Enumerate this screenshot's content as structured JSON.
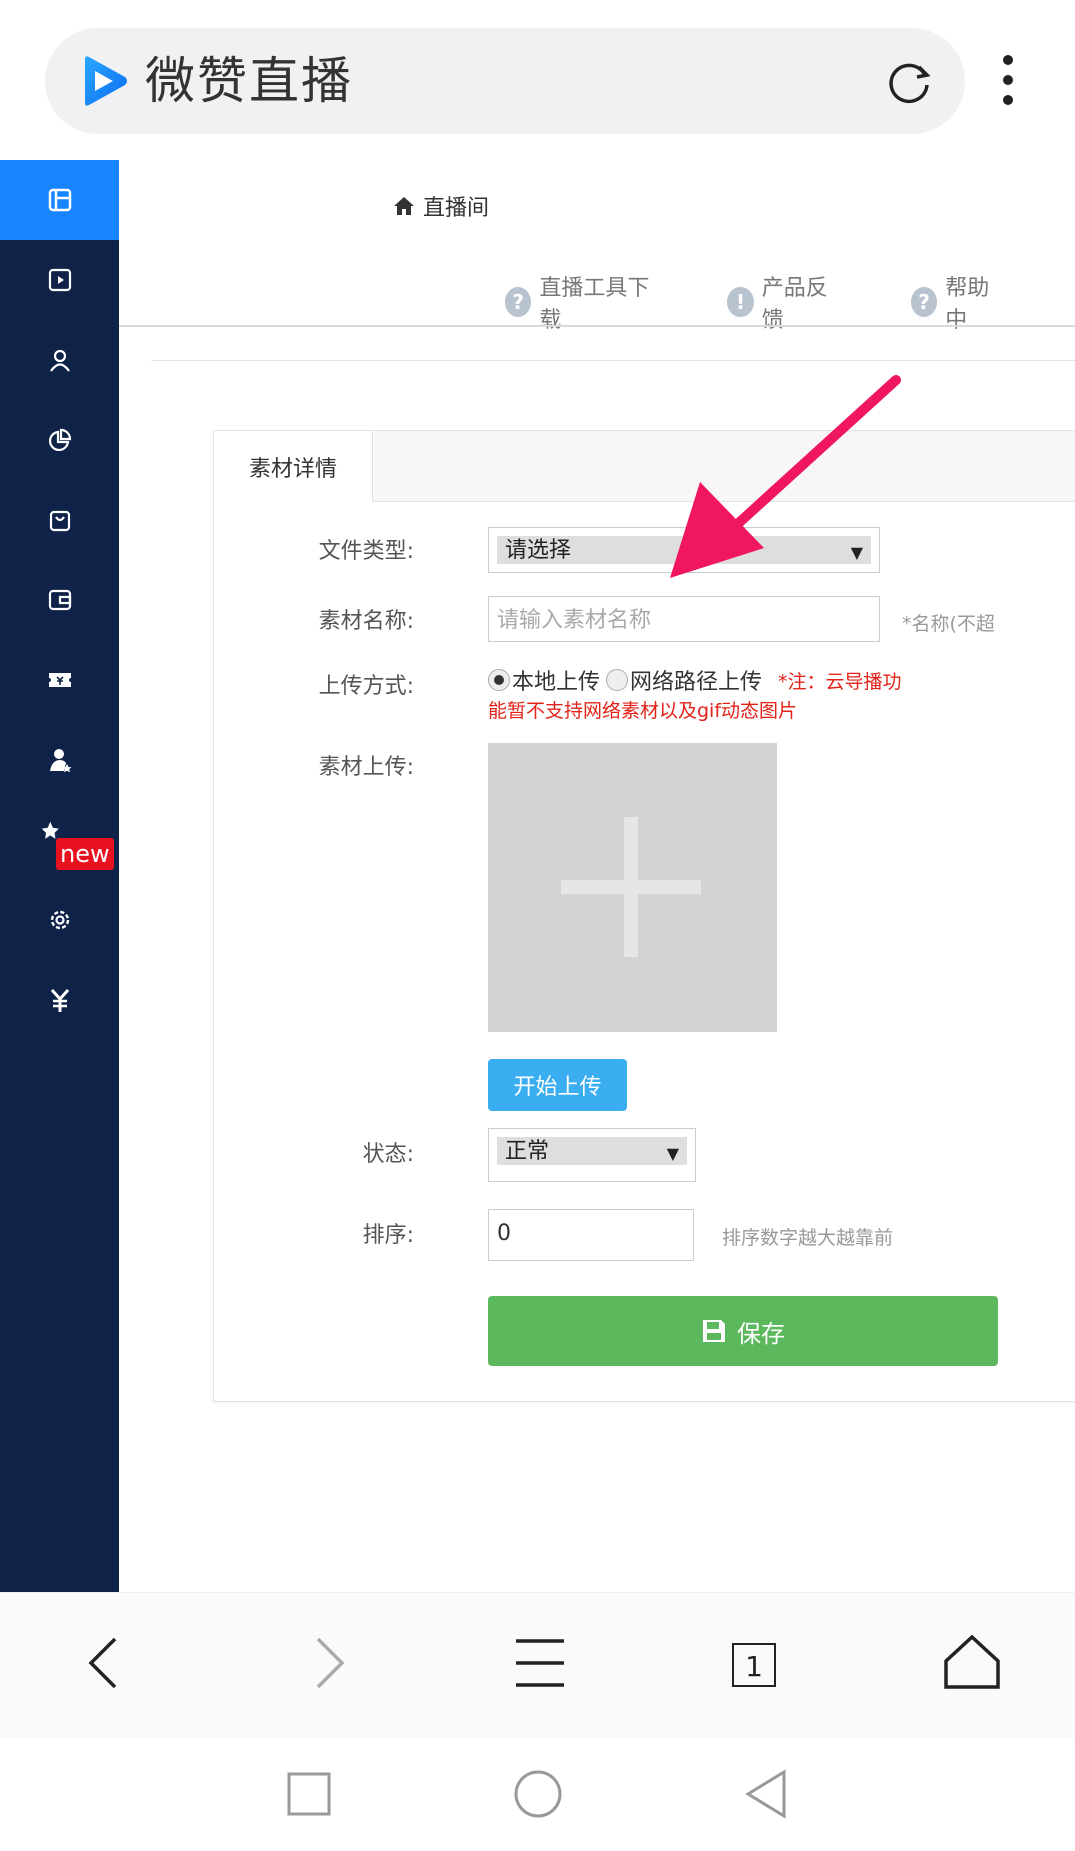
{
  "browser": {
    "site_title": "微赞直播",
    "tab_count": "1"
  },
  "sidebar": {
    "items": [
      {
        "icon": "layout-icon",
        "active": true
      },
      {
        "icon": "video-play-icon"
      },
      {
        "icon": "user-icon"
      },
      {
        "icon": "pie-chart-icon"
      },
      {
        "icon": "shopping-bag-icon"
      },
      {
        "icon": "wallet-icon"
      },
      {
        "icon": "ticket-icon"
      },
      {
        "icon": "user-star-icon"
      },
      {
        "icon": "star-new-icon"
      },
      {
        "icon": "gear-icon"
      },
      {
        "icon": "yuan-icon"
      }
    ],
    "new_badge": "new"
  },
  "header": {
    "breadcrumb": "直播间",
    "links": [
      "直播工具下载",
      "产品反馈",
      "帮助中"
    ]
  },
  "card": {
    "tab_label": "素材详情",
    "file_type_label": "文件类型:",
    "file_type_value": "请选择",
    "name_label": "素材名称:",
    "name_placeholder": "请输入素材名称",
    "name_hint": "*名称(不超",
    "upload_method_label": "上传方式:",
    "upload_local": "本地上传",
    "upload_url": "网络路径上传",
    "upload_note_1": "*注：云导播功",
    "upload_note_2": "能暂不支持网络素材以及gif动态图片",
    "material_upload_label": "素材上传:",
    "start_upload": "开始上传",
    "status_label": "状态:",
    "status_value": "正常",
    "sort_label": "排序:",
    "sort_value": "0",
    "sort_hint": "排序数字越大越靠前",
    "save_label": "保存"
  },
  "colors": {
    "sidebar_bg": "#0f2349",
    "sidebar_active": "#1785ff",
    "save_green": "#5cb85c",
    "upload_blue": "#3aaef0",
    "annotation_arrow": "#f0175f",
    "note_red": "#e2231a"
  }
}
